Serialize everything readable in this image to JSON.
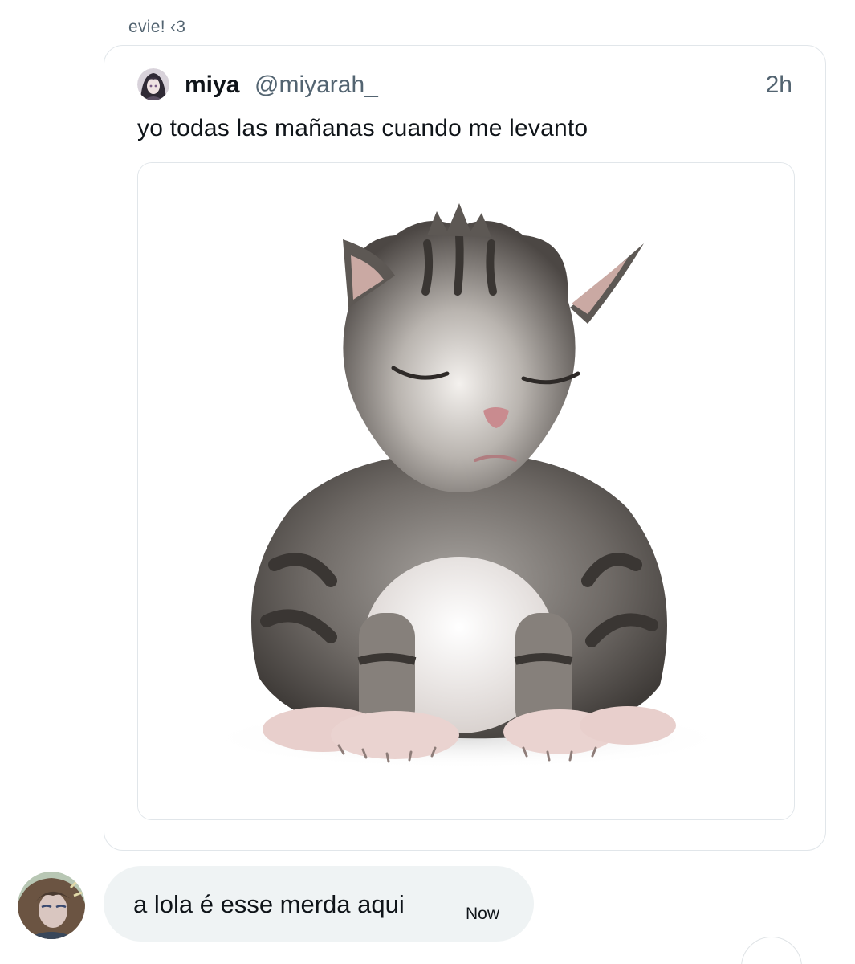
{
  "conversation": {
    "sender_name": "evie! ‹3"
  },
  "quoted_post": {
    "author_name": "miya",
    "author_handle": "@miyarah_",
    "time": "2h",
    "text": "yo todas las mañanas cuando me levanto",
    "media": {
      "kind": "photo",
      "subject": "sleepy kitten",
      "icon": "photo-icon"
    }
  },
  "reply": {
    "text": "a lola é esse merda aqui",
    "time": "Now"
  },
  "colors": {
    "text_primary": "#0f1419",
    "text_secondary": "#536471",
    "border": "#e1e6ea",
    "bubble_bg": "#eff3f4",
    "background": "#ffffff"
  }
}
